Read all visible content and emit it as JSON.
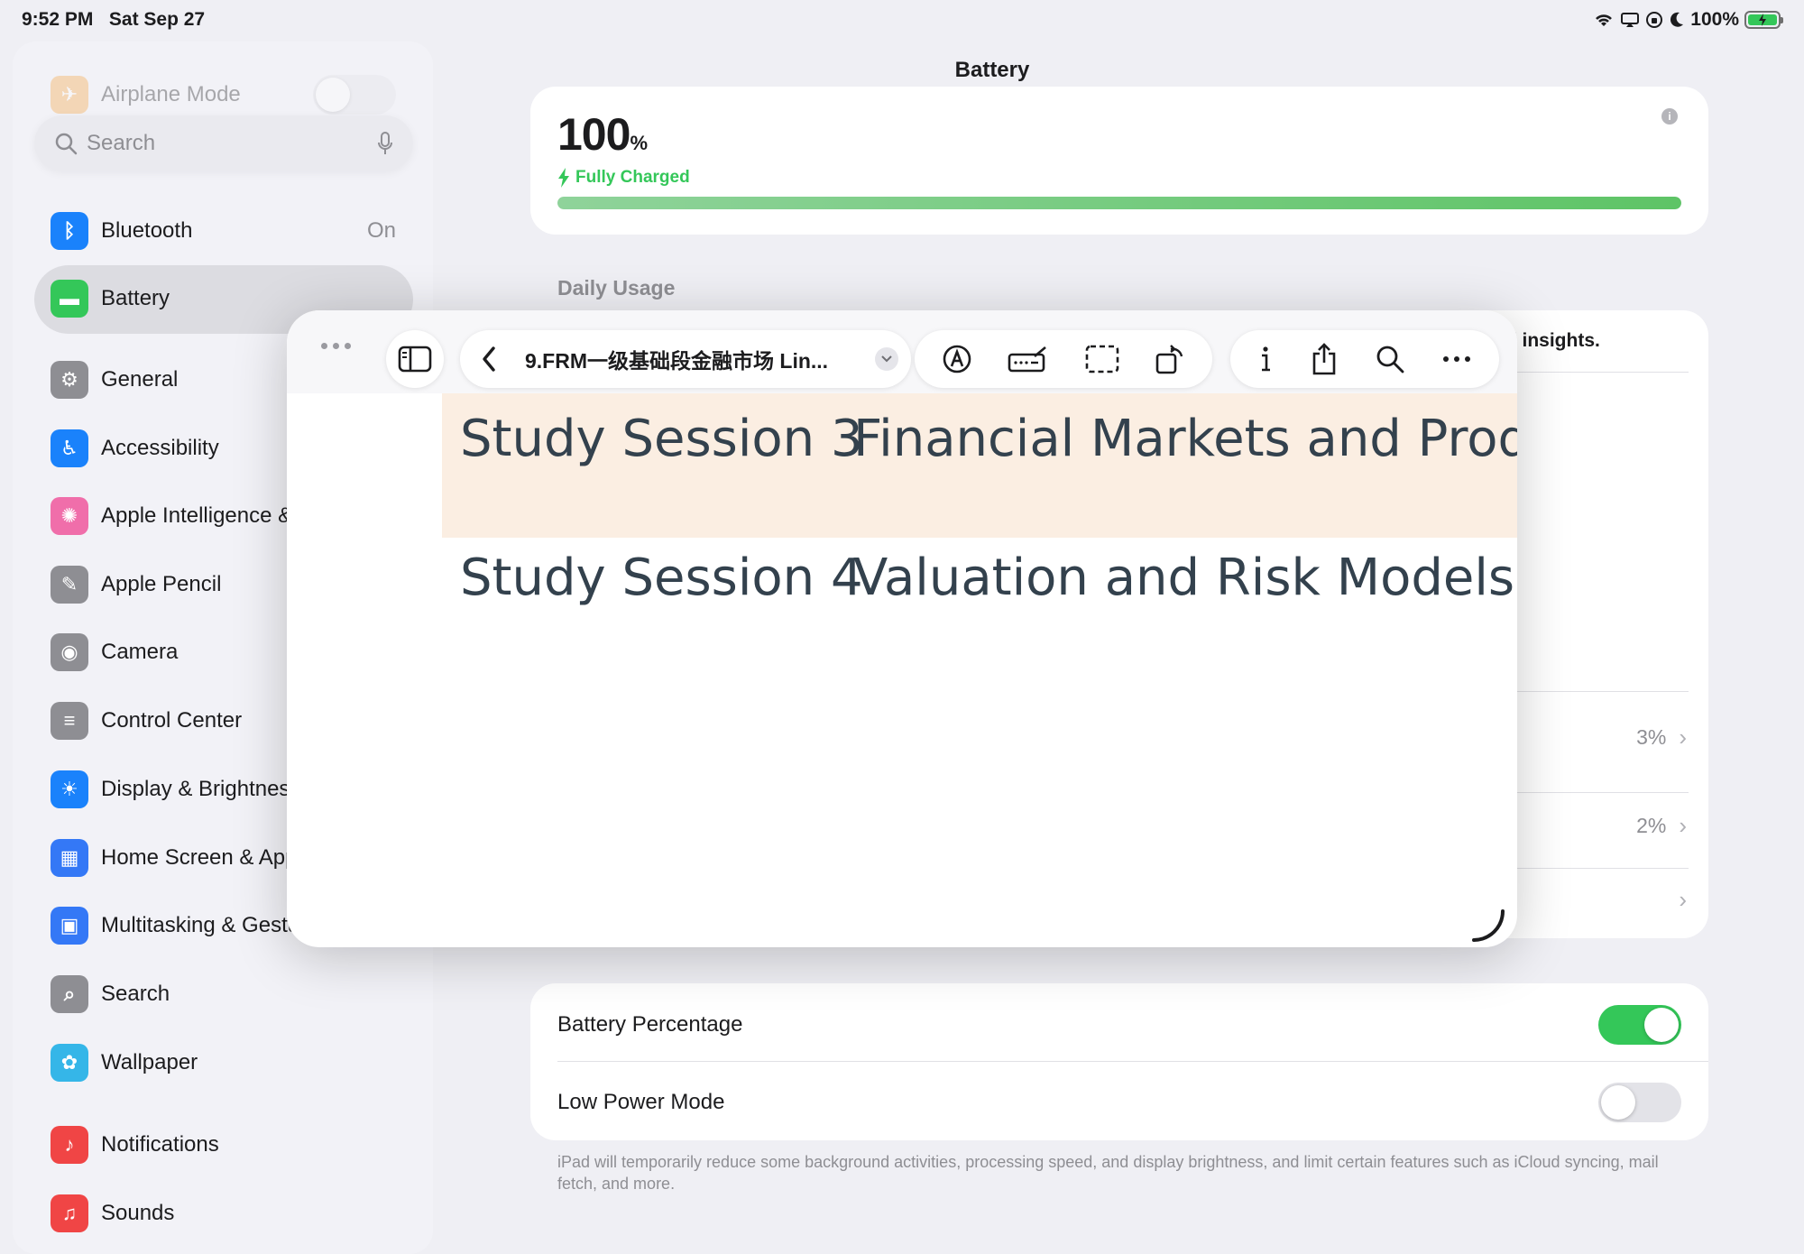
{
  "status_bar": {
    "time": "9:52 PM",
    "date": "Sat Sep 27",
    "battery_percent": "100%"
  },
  "sidebar": {
    "airplane_label": "Airplane Mode",
    "search_placeholder": "Search",
    "items": [
      {
        "label": "Bluetooth",
        "value": "On",
        "icon": "bluetooth-icon",
        "color": "#1a82fb"
      },
      {
        "label": "Battery",
        "value": "",
        "icon": "battery-icon",
        "color": "#34c759",
        "selected": true
      },
      {
        "label": "General",
        "value": "",
        "icon": "gear-icon",
        "color": "#8e8e93"
      },
      {
        "label": "Accessibility",
        "value": "",
        "icon": "accessibility-icon",
        "color": "#1a82fb"
      },
      {
        "label": "Apple Intelligence & Siri",
        "value": "",
        "icon": "apple-intelligence-icon",
        "color": "#f06eaa"
      },
      {
        "label": "Apple Pencil",
        "value": "",
        "icon": "pencil-icon",
        "color": "#8e8e93"
      },
      {
        "label": "Camera",
        "value": "",
        "icon": "camera-icon",
        "color": "#8e8e93"
      },
      {
        "label": "Control Center",
        "value": "",
        "icon": "control-center-icon",
        "color": "#8e8e93"
      },
      {
        "label": "Display & Brightness",
        "value": "",
        "icon": "sun-icon",
        "color": "#1a82fb"
      },
      {
        "label": "Home Screen & App Library",
        "value": "",
        "icon": "home-screen-icon",
        "color": "#3478f6"
      },
      {
        "label": "Multitasking & Gestures",
        "value": "",
        "icon": "multitasking-icon",
        "color": "#3478f6"
      },
      {
        "label": "Search",
        "value": "",
        "icon": "search-icon",
        "color": "#8e8e93"
      },
      {
        "label": "Wallpaper",
        "value": "",
        "icon": "flower-icon",
        "color": "#35b6e8"
      },
      {
        "label": "Notifications",
        "value": "",
        "icon": "bell-icon",
        "color": "#f04545"
      },
      {
        "label": "Sounds",
        "value": "",
        "icon": "speaker-icon",
        "color": "#f04545"
      }
    ]
  },
  "main": {
    "title": "Battery",
    "battery": {
      "percent": "100",
      "percent_sign": "%",
      "status": "Fully Charged",
      "level": 1.0
    },
    "daily_usage_label": "Daily Usage",
    "insights_text": "ll insights.",
    "usage_rows": [
      "3%",
      "2%",
      ""
    ],
    "settings": {
      "battery_percentage_label": "Battery Percentage",
      "battery_percentage_on": true,
      "low_power_label": "Low Power Mode",
      "low_power_on": false
    },
    "footnote": "iPad will temporarily reduce some background activities, processing speed, and display brightness, and limit certain features such as iCloud syncing, mail fetch, and more."
  },
  "floating_window": {
    "doc_title": "9.FRM一级基础段金融市场 Lin...",
    "rows": [
      {
        "session": "Study Session 3",
        "topic": "Financial Markets and Products"
      },
      {
        "session": "Study Session 4",
        "topic": "Valuation and Risk Models"
      }
    ]
  }
}
